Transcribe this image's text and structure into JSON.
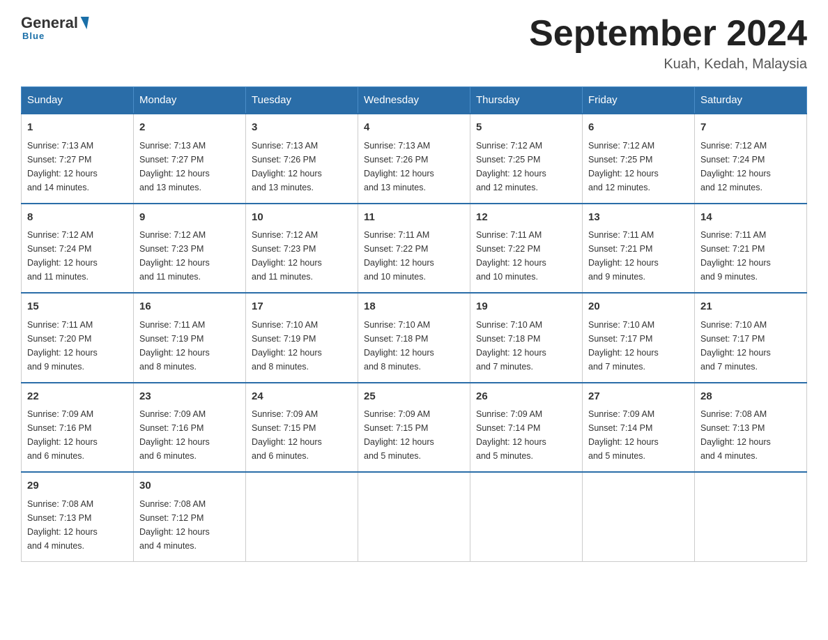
{
  "header": {
    "logo_general": "General",
    "logo_blue": "Blue",
    "page_title": "September 2024",
    "subtitle": "Kuah, Kedah, Malaysia"
  },
  "days_of_week": [
    "Sunday",
    "Monday",
    "Tuesday",
    "Wednesday",
    "Thursday",
    "Friday",
    "Saturday"
  ],
  "weeks": [
    [
      {
        "day": "1",
        "sunrise": "7:13 AM",
        "sunset": "7:27 PM",
        "daylight": "12 hours and 14 minutes."
      },
      {
        "day": "2",
        "sunrise": "7:13 AM",
        "sunset": "7:27 PM",
        "daylight": "12 hours and 13 minutes."
      },
      {
        "day": "3",
        "sunrise": "7:13 AM",
        "sunset": "7:26 PM",
        "daylight": "12 hours and 13 minutes."
      },
      {
        "day": "4",
        "sunrise": "7:13 AM",
        "sunset": "7:26 PM",
        "daylight": "12 hours and 13 minutes."
      },
      {
        "day": "5",
        "sunrise": "7:12 AM",
        "sunset": "7:25 PM",
        "daylight": "12 hours and 12 minutes."
      },
      {
        "day": "6",
        "sunrise": "7:12 AM",
        "sunset": "7:25 PM",
        "daylight": "12 hours and 12 minutes."
      },
      {
        "day": "7",
        "sunrise": "7:12 AM",
        "sunset": "7:24 PM",
        "daylight": "12 hours and 12 minutes."
      }
    ],
    [
      {
        "day": "8",
        "sunrise": "7:12 AM",
        "sunset": "7:24 PM",
        "daylight": "12 hours and 11 minutes."
      },
      {
        "day": "9",
        "sunrise": "7:12 AM",
        "sunset": "7:23 PM",
        "daylight": "12 hours and 11 minutes."
      },
      {
        "day": "10",
        "sunrise": "7:12 AM",
        "sunset": "7:23 PM",
        "daylight": "12 hours and 11 minutes."
      },
      {
        "day": "11",
        "sunrise": "7:11 AM",
        "sunset": "7:22 PM",
        "daylight": "12 hours and 10 minutes."
      },
      {
        "day": "12",
        "sunrise": "7:11 AM",
        "sunset": "7:22 PM",
        "daylight": "12 hours and 10 minutes."
      },
      {
        "day": "13",
        "sunrise": "7:11 AM",
        "sunset": "7:21 PM",
        "daylight": "12 hours and 9 minutes."
      },
      {
        "day": "14",
        "sunrise": "7:11 AM",
        "sunset": "7:21 PM",
        "daylight": "12 hours and 9 minutes."
      }
    ],
    [
      {
        "day": "15",
        "sunrise": "7:11 AM",
        "sunset": "7:20 PM",
        "daylight": "12 hours and 9 minutes."
      },
      {
        "day": "16",
        "sunrise": "7:11 AM",
        "sunset": "7:19 PM",
        "daylight": "12 hours and 8 minutes."
      },
      {
        "day": "17",
        "sunrise": "7:10 AM",
        "sunset": "7:19 PM",
        "daylight": "12 hours and 8 minutes."
      },
      {
        "day": "18",
        "sunrise": "7:10 AM",
        "sunset": "7:18 PM",
        "daylight": "12 hours and 8 minutes."
      },
      {
        "day": "19",
        "sunrise": "7:10 AM",
        "sunset": "7:18 PM",
        "daylight": "12 hours and 7 minutes."
      },
      {
        "day": "20",
        "sunrise": "7:10 AM",
        "sunset": "7:17 PM",
        "daylight": "12 hours and 7 minutes."
      },
      {
        "day": "21",
        "sunrise": "7:10 AM",
        "sunset": "7:17 PM",
        "daylight": "12 hours and 7 minutes."
      }
    ],
    [
      {
        "day": "22",
        "sunrise": "7:09 AM",
        "sunset": "7:16 PM",
        "daylight": "12 hours and 6 minutes."
      },
      {
        "day": "23",
        "sunrise": "7:09 AM",
        "sunset": "7:16 PM",
        "daylight": "12 hours and 6 minutes."
      },
      {
        "day": "24",
        "sunrise": "7:09 AM",
        "sunset": "7:15 PM",
        "daylight": "12 hours and 6 minutes."
      },
      {
        "day": "25",
        "sunrise": "7:09 AM",
        "sunset": "7:15 PM",
        "daylight": "12 hours and 5 minutes."
      },
      {
        "day": "26",
        "sunrise": "7:09 AM",
        "sunset": "7:14 PM",
        "daylight": "12 hours and 5 minutes."
      },
      {
        "day": "27",
        "sunrise": "7:09 AM",
        "sunset": "7:14 PM",
        "daylight": "12 hours and 5 minutes."
      },
      {
        "day": "28",
        "sunrise": "7:08 AM",
        "sunset": "7:13 PM",
        "daylight": "12 hours and 4 minutes."
      }
    ],
    [
      {
        "day": "29",
        "sunrise": "7:08 AM",
        "sunset": "7:13 PM",
        "daylight": "12 hours and 4 minutes."
      },
      {
        "day": "30",
        "sunrise": "7:08 AM",
        "sunset": "7:12 PM",
        "daylight": "12 hours and 4 minutes."
      },
      null,
      null,
      null,
      null,
      null
    ]
  ],
  "labels": {
    "sunrise": "Sunrise:",
    "sunset": "Sunset:",
    "daylight": "Daylight:"
  }
}
